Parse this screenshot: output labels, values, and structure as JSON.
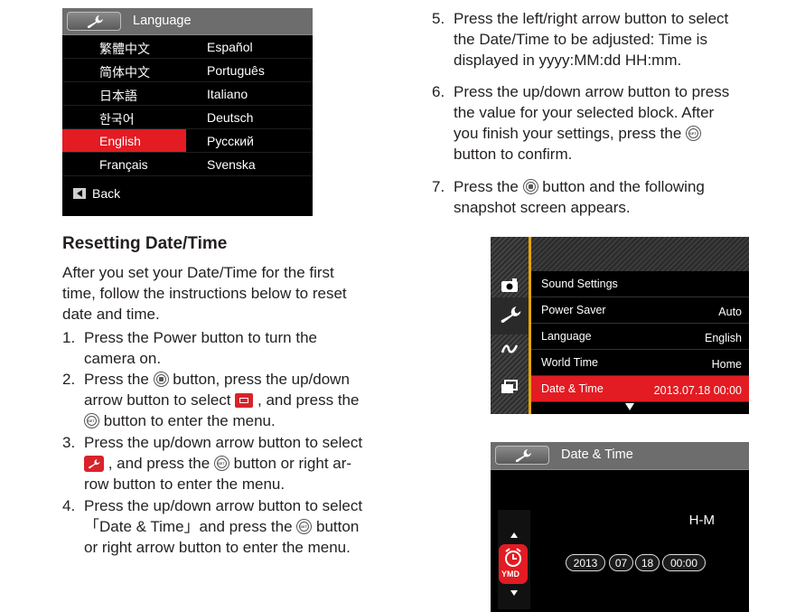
{
  "language_screen": {
    "title": "Language",
    "left_column": [
      "繁體中文",
      "简体中文",
      "日本語",
      "한국어",
      "English",
      "Français"
    ],
    "right_column": [
      "Español",
      "Português",
      "Italiano",
      "Deutsch",
      "Русский",
      "Svenska"
    ],
    "selected": "English",
    "back_label": "Back"
  },
  "section": {
    "heading": "Resetting Date/Time",
    "intro": "After you set your Date/Time for the first time, follow the instructions below to reset date and time."
  },
  "steps": [
    {
      "num": "1.",
      "lines": [
        "Press the Power button to turn the",
        "camera on."
      ]
    },
    {
      "num": "2.",
      "parts": [
        "Press the",
        "button, press the up/down",
        "arrow button to select",
        ", and press the",
        "button to enter the menu."
      ]
    },
    {
      "num": "3.",
      "parts": [
        "Press the up/down arrow button to select",
        ", and press the",
        "button or right ar-",
        "row button to enter the menu."
      ]
    },
    {
      "num": "4.",
      "parts": [
        "Press the up/down arrow button to select",
        "「Date & Time」and press the",
        "button",
        "or right arrow button to enter the menu."
      ]
    },
    {
      "num": "5.",
      "lines": [
        "Press the left/right arrow button to select",
        "the Date/Time to be adjusted: Time is",
        "displayed in yyyy:MM:dd HH:mm."
      ]
    },
    {
      "num": "6.",
      "parts": [
        "Press the up/down arrow button to press",
        "the value for your selected block. After",
        "you finish your settings, press the",
        "button to confirm."
      ]
    },
    {
      "num": "7.",
      "parts": [
        "Press the",
        "button and the following",
        "snapshot screen appears."
      ]
    }
  ],
  "menu_screen": {
    "items": [
      {
        "label": "Sound Settings",
        "value": ""
      },
      {
        "label": "Power Saver",
        "value": "Auto"
      },
      {
        "label": "Language",
        "value": "English"
      },
      {
        "label": "World Time",
        "value": "Home"
      },
      {
        "label": "Date & Time",
        "value": "2013.07.18 00:00"
      }
    ],
    "selected": "Date & Time"
  },
  "datetime_screen": {
    "title": "Date & Time",
    "format": "H-M",
    "mode_icon_label": "YMD",
    "fields": [
      "2013",
      "07",
      "18",
      "00:00"
    ]
  },
  "colors": {
    "accent_red": "#e31b23",
    "menu_gold": "#e8a400",
    "header_gray": "#6d6d6d"
  }
}
